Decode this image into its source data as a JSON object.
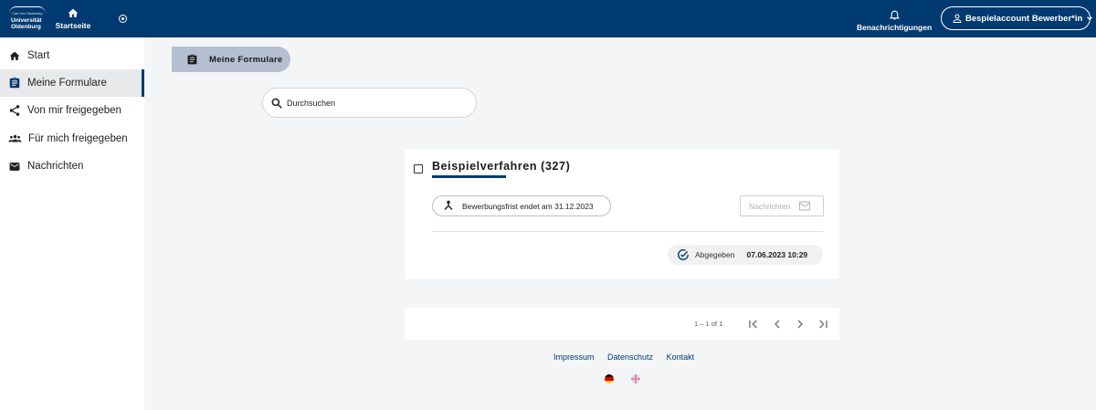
{
  "header": {
    "logo": {
      "small_text": "Carl von Ossietzky",
      "line1": "Universität",
      "line2": "Oldenburg"
    },
    "home_label": "Startseite",
    "notifications_label": "Benachrichtigungen",
    "account_label": "Bespielaccount Bewerber*in",
    "color": "#003a70"
  },
  "sidebar": {
    "items": [
      {
        "label": "Start",
        "icon": "home-icon"
      },
      {
        "label": "Meine Formulare",
        "icon": "clipboard-icon",
        "active": true
      },
      {
        "label": "Von mir freigegeben",
        "icon": "share-icon"
      },
      {
        "label": "Für mich freigegeben",
        "icon": "group-icon"
      },
      {
        "label": "Nachrichten",
        "icon": "mail-icon"
      }
    ]
  },
  "main": {
    "tab_label": "Meine Formulare",
    "search_placeholder": "Durchsuchen",
    "card": {
      "title": "Beispielverfahren (327)",
      "deadline": "Bewerbungsfrist endet am 31.12.2023",
      "messages_button": "Nachrichten",
      "status_label": "Abgegeben",
      "status_date": "07.06.2023 10:29"
    },
    "pagination": {
      "range": "1 – 1 of 1"
    }
  },
  "footer": {
    "links": [
      "Impressum",
      "Datenschutz",
      "Kontakt"
    ],
    "languages": [
      "de-flag-icon",
      "en-flag-icon"
    ]
  }
}
